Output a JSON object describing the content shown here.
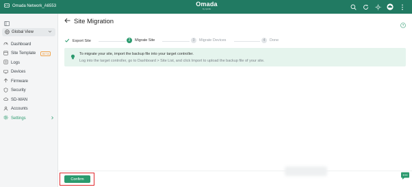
{
  "topbar": {
    "network": "Omada Network_A6553",
    "logo": "Omada",
    "logo_sub": "by tp-link",
    "accent": "#217a62"
  },
  "sidebar": {
    "global_view": "Global View",
    "items": [
      {
        "label": "Dashboard",
        "icon": "dashboard-icon"
      },
      {
        "label": "Site Template",
        "icon": "template-icon",
        "badge": "BETA"
      },
      {
        "label": "Logs",
        "icon": "logs-icon"
      },
      {
        "label": "Devices",
        "icon": "devices-icon"
      },
      {
        "label": "Firmware",
        "icon": "firmware-icon"
      },
      {
        "label": "Security",
        "icon": "shield-icon"
      },
      {
        "label": "SD-WAN",
        "icon": "cloud-icon"
      },
      {
        "label": "Accounts",
        "icon": "accounts-icon"
      },
      {
        "label": "Settings",
        "icon": "gear-icon",
        "active": true
      }
    ]
  },
  "page": {
    "title": "Site Migration"
  },
  "steps": [
    {
      "label": "Export Site",
      "state": "done"
    },
    {
      "num": "2",
      "label": "Migrate Site",
      "state": "current"
    },
    {
      "num": "3",
      "label": "Migrate Devices",
      "state": "pending"
    },
    {
      "num": "4",
      "label": "Done",
      "state": "pending"
    }
  ],
  "info": {
    "line1": "To migrate your site, import the backup file into your target controller.",
    "line2": "Log into the target controller, go to Dashboard > Site List, and click Import to upload the backup file of your site."
  },
  "footer": {
    "confirm": "Confirm"
  },
  "colors": {
    "primary": "#2b9a6e",
    "highlight": "#e0262a"
  }
}
